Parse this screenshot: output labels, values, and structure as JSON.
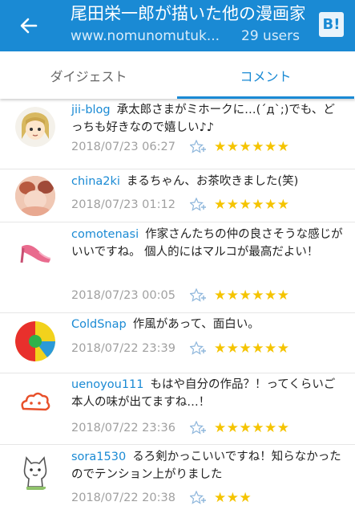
{
  "header": {
    "title": "尾田栄一郎が描いた他の漫画家のキャラ",
    "url": "www.nomunomutuk...",
    "users": "29 users",
    "logo": "B!"
  },
  "tabs": [
    {
      "label": "ダイジェスト"
    },
    {
      "label": "コメント"
    }
  ],
  "comments": [
    {
      "user": "jii-blog",
      "text": "承太郎さまがミホークに…(´д`;)でも、どっちも好きなので嬉しい♪♪",
      "date": "2018/07/23 06:27",
      "stars": "★★★★★★"
    },
    {
      "user": "china2ki",
      "text": "まるちゃん、お茶吹きました(笑)",
      "date": "2018/07/23 01:12",
      "stars": "★★★★★★"
    },
    {
      "user": "comotenasi",
      "text": "作家さんたちの仲の良さそうな感じがいいですね。 個人的にはマルコが最高だよい！",
      "date": "2018/07/23 00:05",
      "stars": "★★★★★★"
    },
    {
      "user": "ColdSnap",
      "text": "作風があって、面白い。",
      "date": "2018/07/22 23:39",
      "stars": "★★★★★★"
    },
    {
      "user": "uenoyou111",
      "text": "もはや自分の作品？！ってくらいご本人の味が出てますね…！",
      "date": "2018/07/22 23:36",
      "stars": "★★★★★★"
    },
    {
      "user": "sora1530",
      "text": "るろ剣かっこいいですね！知らなかったのでテンション上がりました",
      "date": "2018/07/22 20:38",
      "stars": "★★★"
    }
  ]
}
